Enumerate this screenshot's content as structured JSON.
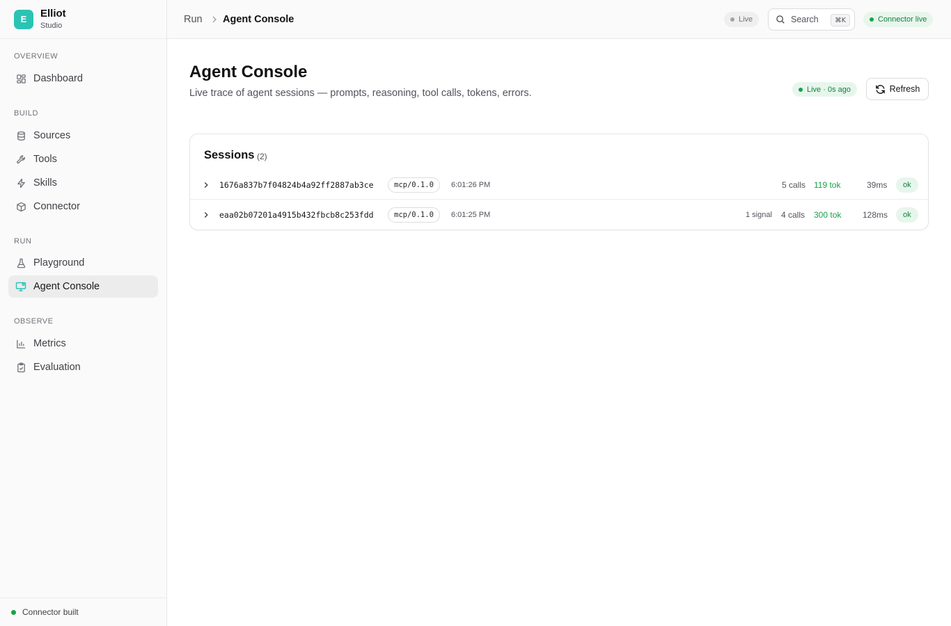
{
  "brand": {
    "initial": "E",
    "name": "Elliot",
    "sub": "Studio"
  },
  "sidebar": {
    "sections": {
      "overview": "OVERVIEW",
      "build": "BUILD",
      "run": "RUN",
      "observe": "OBSERVE"
    },
    "items": [
      {
        "label": "Dashboard",
        "icon": "dashboard-icon"
      },
      {
        "label": "Sources",
        "icon": "database-icon"
      },
      {
        "label": "Tools",
        "icon": "wrench-icon"
      },
      {
        "label": "Skills",
        "icon": "bolt-icon"
      },
      {
        "label": "Connector",
        "icon": "box-icon"
      },
      {
        "label": "Playground",
        "icon": "flask-icon"
      },
      {
        "label": "Agent Console",
        "icon": "monitor-icon",
        "active": true
      },
      {
        "label": "Metrics",
        "icon": "bar-chart-icon"
      },
      {
        "label": "Evaluation",
        "icon": "clipboard-check-icon"
      }
    ],
    "footer": "Connector built"
  },
  "topbar": {
    "breadcrumb_parent": "Run",
    "breadcrumb_current": "Agent Console",
    "live_label": "Live",
    "search_label": "Search",
    "search_shortcut": "⌘K",
    "connector_status": "Connector live"
  },
  "page": {
    "title": "Agent Console",
    "subtitle": "Live trace of agent sessions — prompts, reasoning, tool calls, tokens, errors.",
    "live_status": "Live · 0s ago",
    "refresh_label": "Refresh"
  },
  "sessions": {
    "title": "Sessions",
    "count": "(2)",
    "rows": [
      {
        "id": "1676a837b7f04824b4a92ff2887ab3ce",
        "protocol": "mcp/0.1.0",
        "time": "6:01:26 PM",
        "signal": "",
        "calls": "5 calls",
        "tokens": "119 tok",
        "duration": "39ms",
        "status": "ok"
      },
      {
        "id": "eaa02b07201a4915b432fbcb8c253fdd",
        "protocol": "mcp/0.1.0",
        "time": "6:01:25 PM",
        "signal": "1 signal",
        "calls": "4 calls",
        "tokens": "300 tok",
        "duration": "128ms",
        "status": "ok"
      }
    ]
  },
  "colors": {
    "accent": "#2ac3b4",
    "success": "#16a34a",
    "success_bg": "#e7f6ec"
  }
}
